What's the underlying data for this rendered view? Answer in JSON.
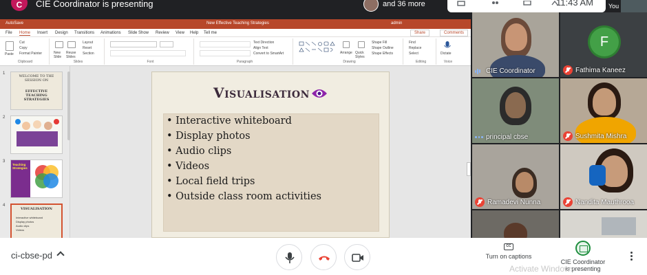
{
  "meet_top": {
    "presenter_initial": "C",
    "presenter_text": "CIE Coordinator is presenting",
    "participants_more": "and 36 more",
    "clock": "11:43 AM",
    "you_label": "You"
  },
  "ppt": {
    "autosave": "AutoSave",
    "doc_title": "New Effective Teaching Strategies",
    "user": "admin",
    "tabs": [
      "File",
      "Home",
      "Insert",
      "Design",
      "Transitions",
      "Animations",
      "Slide Show",
      "Review",
      "View",
      "Help",
      "Tell me"
    ],
    "share": "Share",
    "comments": "Comments",
    "groups": {
      "clipboard": "Clipboard",
      "slides": "Slides",
      "font": "Font",
      "paragraph": "Paragraph",
      "drawing": "Drawing",
      "editing": "Editing",
      "voice": "Voice"
    },
    "ribbon_items": {
      "paste": "Paste",
      "cut": "Cut",
      "copy": "Copy",
      "format_painter": "Format Painter",
      "new_slide": "New Slide",
      "reuse_slides": "Reuse Slides",
      "layout": "Layout",
      "reset": "Reset",
      "section": "Section",
      "text_direction": "Text Direction",
      "align_text": "Align Text",
      "smartart": "Convert to SmartArt",
      "arrange": "Arrange",
      "quick_styles": "Quick Styles",
      "shape_fill": "Shape Fill",
      "shape_outline": "Shape Outline",
      "shape_effects": "Shape Effects",
      "find": "Find",
      "replace": "Replace",
      "select": "Select",
      "dictate": "Dictate"
    },
    "thumbnails": [
      {
        "num": "1",
        "title": "WELCOME TO THE SESSION ON",
        "subtitle": "EFFECTIVE TEACHING STRATEGIES"
      },
      {
        "num": "2"
      },
      {
        "num": "3",
        "title": "Teaching Strategies"
      },
      {
        "num": "4",
        "title": "VISUALISATION"
      }
    ],
    "slide": {
      "title": "Visualisation",
      "bullets": [
        "Interactive whiteboard",
        "Display photos",
        "Audio clips",
        "Videos",
        "Local field trips",
        "Outside class room activities"
      ]
    }
  },
  "participants": [
    {
      "name": "CIE Coordinator",
      "status": "speaking"
    },
    {
      "name": "Fathima Kaneez",
      "status": "muted",
      "initial": "F"
    },
    {
      "name": "principal cbse",
      "status": "connecting"
    },
    {
      "name": "Sushmita Mishra",
      "status": "muted"
    },
    {
      "name": "Ramadevi Nunna",
      "status": "muted"
    },
    {
      "name": "Nandita Mauthrooa",
      "status": "muted"
    }
  ],
  "bottom": {
    "meeting_code": "ci-cbse-pd",
    "captions": "Turn on captions",
    "presenting_line1": "CIE Coordinator",
    "presenting_line2": "is presenting",
    "watermark": "Activate Windows"
  },
  "colors": {
    "ppt_accent": "#b7472a",
    "meet_dark": "#202124",
    "end_call": "#ea4335",
    "present_green": "#1e8e3e"
  }
}
